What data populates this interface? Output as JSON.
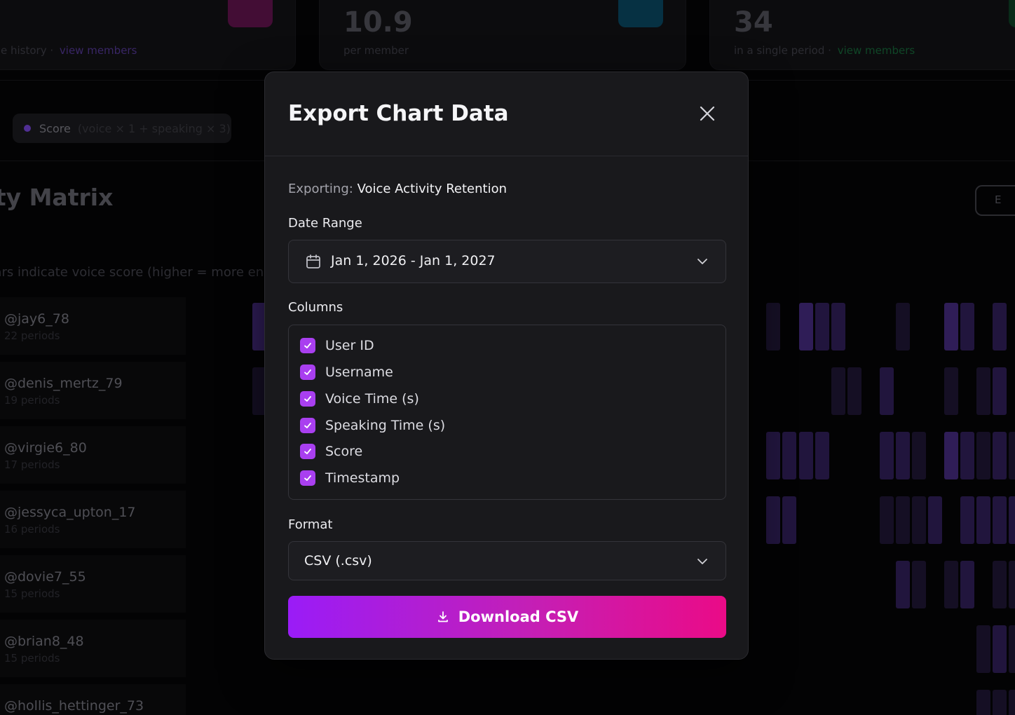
{
  "background": {
    "stats": [
      {
        "value": "",
        "sub": "e history",
        "link": "view members"
      },
      {
        "value": "10.9",
        "sub": "per member",
        "link": ""
      },
      {
        "value": "34",
        "sub": "in a single period",
        "link": "view members"
      }
    ],
    "score_pill": {
      "label": "Score",
      "formula": "(voice × 1 + speaking × 3)"
    },
    "matrix_title": "vity Matrix",
    "matrix_subtitle": "bars indicate voice score (higher = more en",
    "export_button_label": "E",
    "members": [
      {
        "name": "@jay6_78",
        "periods": "22 periods"
      },
      {
        "name": "@denis_mertz_79",
        "periods": "19 periods"
      },
      {
        "name": "@virgie6_80",
        "periods": "17 periods"
      },
      {
        "name": "@jessyca_upton_17",
        "periods": "16 periods"
      },
      {
        "name": "@dovie7_55",
        "periods": "15 periods"
      },
      {
        "name": "@brian8_48",
        "periods": "15 periods"
      },
      {
        "name": "@hollis_hettinger_73",
        "periods": ""
      }
    ],
    "colors": {
      "accent_purple": "#6b3fc6",
      "accent_pink": "#a0247a",
      "accent_cyan": "#0e8fb4",
      "accent_green": "#1f9d55"
    }
  },
  "modal": {
    "title": "Export Chart Data",
    "exporting_label": "Exporting:",
    "exporting_value": "Voice Activity Retention",
    "date_range_label": "Date Range",
    "date_range_value": "Jan 1, 2026 - Jan 1, 2027",
    "columns_label": "Columns",
    "columns": [
      {
        "label": "User ID",
        "checked": true
      },
      {
        "label": "Username",
        "checked": true
      },
      {
        "label": "Voice Time (s)",
        "checked": true
      },
      {
        "label": "Speaking Time (s)",
        "checked": true
      },
      {
        "label": "Score",
        "checked": true
      },
      {
        "label": "Timestamp",
        "checked": true
      }
    ],
    "format_label": "Format",
    "format_value": "CSV (.csv)",
    "download_label": "Download CSV",
    "colors": {
      "checkbox": "#a93ff0",
      "button_start": "#9a1cf7",
      "button_end": "#ea0b87"
    }
  }
}
